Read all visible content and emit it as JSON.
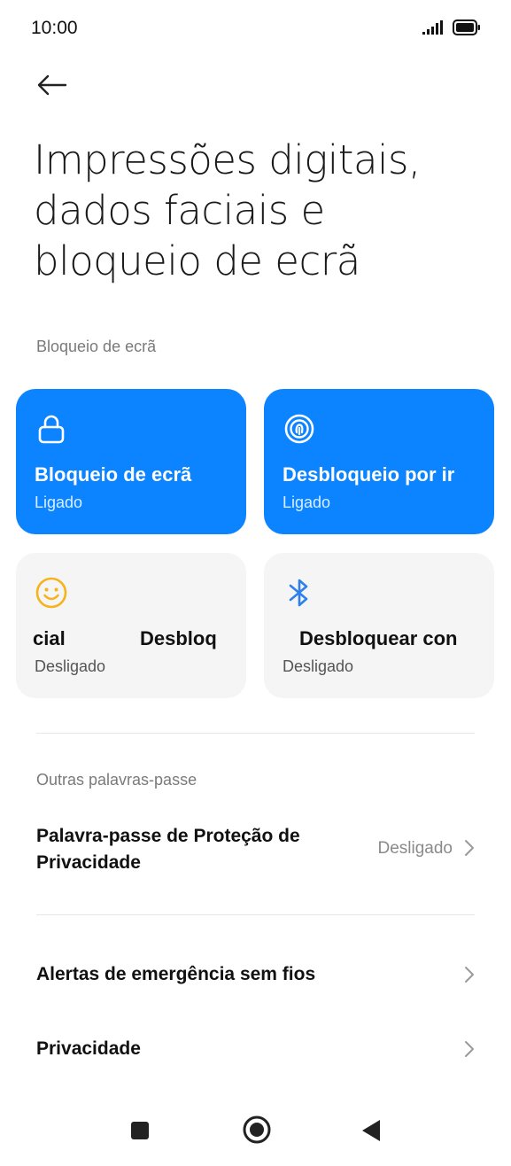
{
  "status_bar": {
    "time": "10:00"
  },
  "header": {
    "title": "Impressões digitais, dados faciais e bloqueio de ecrã"
  },
  "sections": {
    "screen_lock_header": "Bloqueio de ecrã",
    "other_passwords_header": "Outras palavras-passe"
  },
  "tiles": [
    {
      "title": "Bloqueio de ecrã",
      "status": "Ligado",
      "icon": "lock-icon",
      "active": true
    },
    {
      "title": "Desbloqueio por impressão digital",
      "visible_title": "Desbloqueio por ir",
      "status": "Ligado",
      "icon": "fingerprint-icon",
      "active": true
    },
    {
      "title_left": "cial",
      "title_right": "Desbloq",
      "status": "Desligado",
      "icon": "face-icon",
      "active": false
    },
    {
      "title": "Desbloquear con",
      "status": "Desligado",
      "icon": "bluetooth-icon",
      "active": false
    }
  ],
  "rows": {
    "privacy_password": {
      "title_line1": "Palavra-passe de Proteção de",
      "title_line2": "Privacidade",
      "value": "Desligado"
    },
    "emergency_alerts": {
      "title": "Alertas de emergência sem fios"
    },
    "privacy": {
      "title": "Privacidade"
    }
  },
  "colors": {
    "accent": "#0d84ff",
    "tile_grey": "#f5f5f5",
    "face_icon": "#f5b31c",
    "bluetooth_icon": "#2f80ed"
  }
}
